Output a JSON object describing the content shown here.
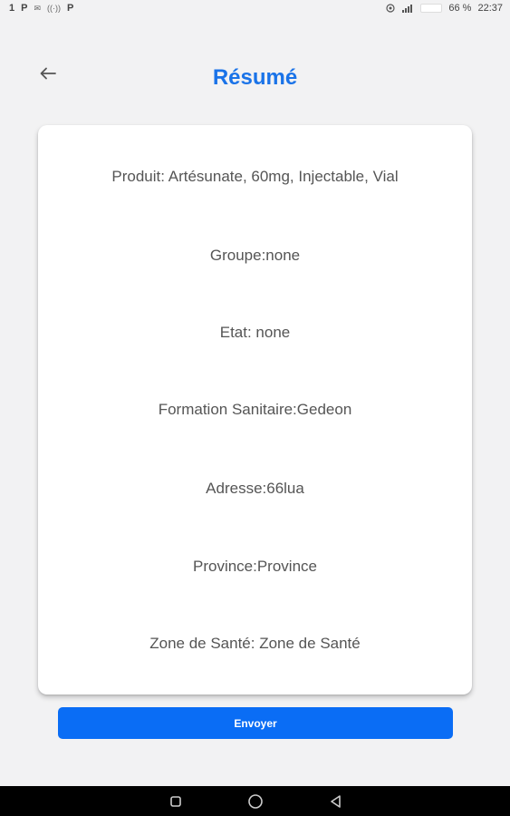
{
  "status_bar": {
    "left_items": [
      "1",
      "P",
      "✉",
      "((·))",
      "P"
    ],
    "battery_text": "66 %",
    "time": "22:37"
  },
  "header": {
    "title": "Résumé",
    "back_icon": "arrow-left-icon"
  },
  "summary": {
    "produit": "Produit: Artésunate, 60mg, Injectable, Vial",
    "groupe": "Groupe:none",
    "etat": "Etat: none",
    "formation": "Formation Sanitaire:Gedeon",
    "adresse": "Adresse:66lua",
    "province": "Province:Province",
    "zone": "Zone de Santé: Zone de Santé"
  },
  "actions": {
    "submit_label": "Envoyer"
  },
  "colors": {
    "accent": "#1a73e8",
    "button": "#0a6df5",
    "background": "#f2f2f3"
  }
}
